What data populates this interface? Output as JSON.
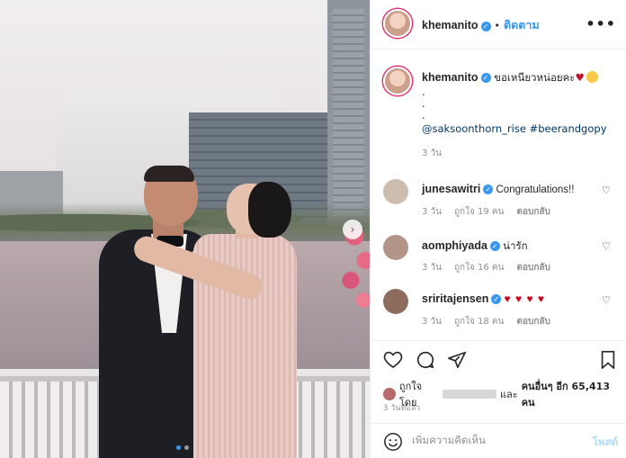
{
  "post": {
    "author": "khemanito",
    "follow_label": "ติดตาม",
    "more_label": "•••",
    "caption": {
      "text": "ขอเหนียวหน่อยคะ",
      "heart": "♥",
      "dots": [
        ".",
        ".",
        "."
      ],
      "mention": "@saksoonthorn_rise",
      "hashtag": "#beerandgopy",
      "time": "3 วัน"
    },
    "nav_next": "›"
  },
  "comments": [
    {
      "user": "junesawitri",
      "verified": true,
      "text": "Congratulations!!",
      "time": "3 วัน",
      "likes": "ถูกใจ 19 คน",
      "reply": "ตอบกลับ",
      "avatar_color": "#c9b8a8"
    },
    {
      "user": "aomphiyada",
      "verified": true,
      "text": "น่ารัก",
      "time": "3 วัน",
      "likes": "ถูกใจ 16 คน",
      "reply": "ตอบกลับ",
      "avatar_color": "#b39588"
    },
    {
      "user": "sriritajensen",
      "verified": true,
      "text": "♥ ♥ ♥ ♥",
      "time": "3 วัน",
      "likes": "ถูกใจ 18 คน",
      "reply": "ตอบกลับ",
      "avatar_color": "#8d6c5e"
    }
  ],
  "likes_line": {
    "prefix": "ถูกใจโดย",
    "and": "และ",
    "others": "คนอื่นๆ อีก 65,413 คน"
  },
  "post_time": "3 วันที่แล้ว",
  "comment_box": {
    "placeholder": "เพิ่มความคิดเห็น",
    "post_label": "โพสต์"
  },
  "colors": {
    "accent": "#3897f0",
    "story_ring": "#e1306c",
    "heart_red": "#d0021b",
    "muted": "#8e8e8e"
  },
  "icons": [
    "heart-icon",
    "comment-icon",
    "share-icon",
    "bookmark-icon",
    "emoji-icon",
    "verified-icon"
  ],
  "carousel": {
    "count": 2,
    "active": 1
  }
}
